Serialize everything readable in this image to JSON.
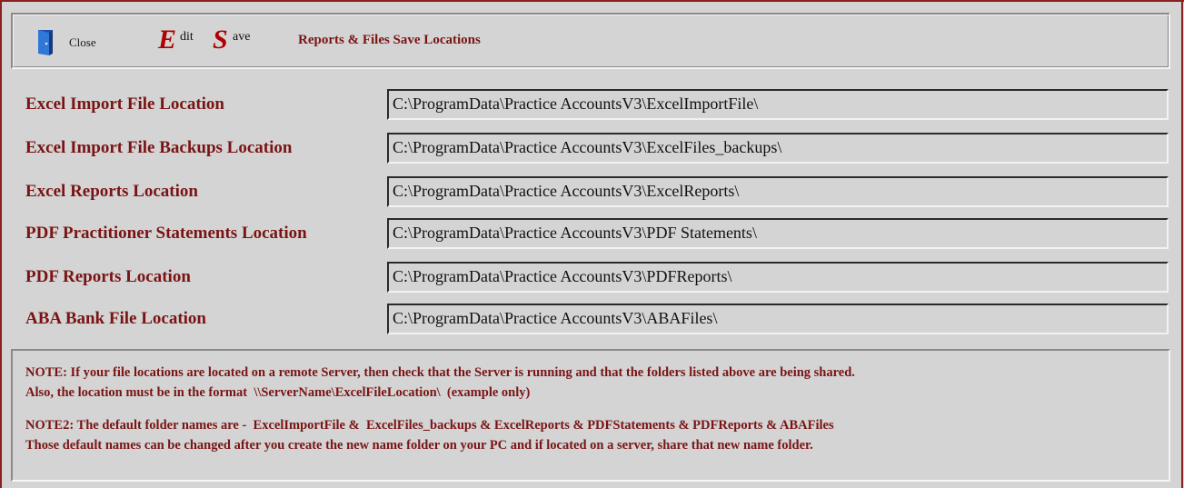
{
  "toolbar": {
    "close_label": "Close",
    "edit_big": "E",
    "edit_small": "dit",
    "save_big": "S",
    "save_small": "ave",
    "title": "Reports & Files Save Locations",
    "close_icon": "door-exit-icon"
  },
  "locations": [
    {
      "label": "Excel Import File Location",
      "value": "C:\\ProgramData\\Practice AccountsV3\\ExcelImportFile\\"
    },
    {
      "label": "Excel Import File Backups Location",
      "value": "C:\\ProgramData\\Practice AccountsV3\\ExcelFiles_backups\\"
    },
    {
      "label": "Excel Reports Location",
      "value": "C:\\ProgramData\\Practice AccountsV3\\ExcelReports\\"
    },
    {
      "label": "PDF Practitioner Statements Location",
      "value": "C:\\ProgramData\\Practice AccountsV3\\PDF Statements\\"
    },
    {
      "label": "PDF Reports Location",
      "value": "C:\\ProgramData\\Practice AccountsV3\\PDFReports\\"
    },
    {
      "label": "ABA Bank File Location",
      "value": "C:\\ProgramData\\Practice AccountsV3\\ABAFiles\\"
    }
  ],
  "notes": {
    "note1_line1": "NOTE: If your file locations are located on a remote Server, then check that the Server is running and that the folders listed above are being shared.",
    "note1_line2": "Also, the location must be in the format  \\\\ServerName\\ExcelFileLocation\\  (example only)",
    "note2_line1": "NOTE2: The default folder names are -  ExcelImportFile &  ExcelFiles_backups & ExcelReports & PDFStatements & PDFReports & ABAFiles",
    "note2_line2": "Those default names can be changed after you create the new name folder on your PC and if located on a server, share that new name folder."
  },
  "colors": {
    "label": "#7a1414",
    "accent": "#b00000",
    "background": "#d4d4d4"
  }
}
